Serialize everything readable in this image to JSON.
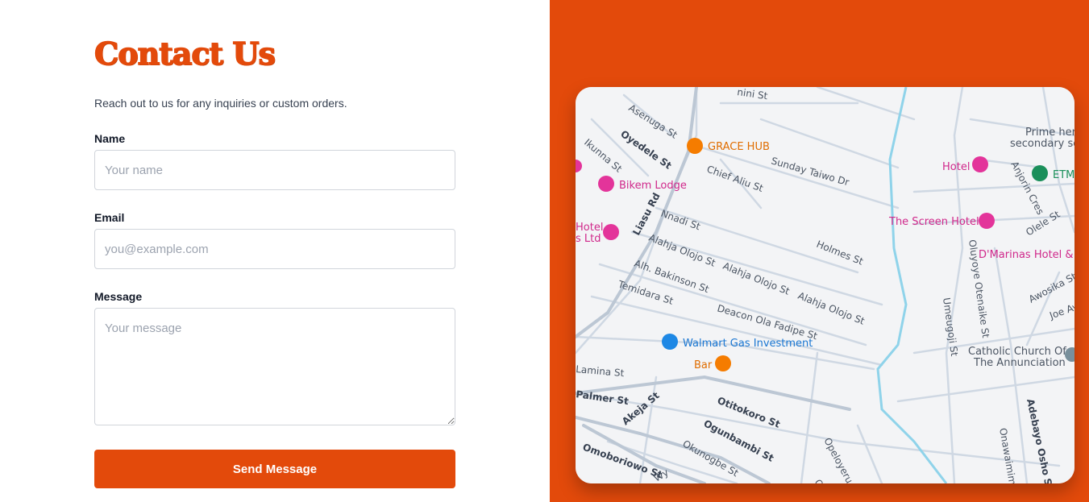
{
  "contact": {
    "title": "Contact Us",
    "subtitle": "Reach out to us for any inquiries or custom orders.",
    "name_label": "Name",
    "name_placeholder": "Your name",
    "email_label": "Email",
    "email_placeholder": "you@example.com",
    "message_label": "Message",
    "message_placeholder": "Your message",
    "submit_label": "Send Message",
    "accent_color": "#e34a0b"
  },
  "map": {
    "streets": [
      "Asenuga St",
      "Oyedele St",
      "Ikunna St",
      "Liasu Rd",
      "Chief Aliu St",
      "Sunday Taiwo Dr",
      "Nnadi St",
      "Alahja Olojo St",
      "Alahja Olojo St",
      "Alahja Olojo St",
      "Holmes St",
      "Alh. Bakinson St",
      "Temidara St",
      "Deacon Ola Fadipe St",
      "Lamina St",
      "Palmer St",
      "Akeja St",
      "Otitokoro St",
      "Ogunbambi St",
      "Okunogbe St",
      "Omoboriowo St",
      "Opeloyeru St",
      "Oluyoye Otenaike St",
      "Umeugoji St",
      "Olele St",
      "Anjorin Cres",
      "Awosika St",
      "Joe Ayik",
      "Adebayo Osho St",
      "Onawaimim",
      "Wy",
      "nini St",
      "Otto"
    ],
    "places": [
      {
        "name": "GRACE HUB",
        "icon": "bar-icon"
      },
      {
        "name": "Bikem Lodge",
        "icon": "hotel-icon"
      },
      {
        "name": "Hotel",
        "icon": "hotel-icon"
      },
      {
        "name": "s Ltd",
        "icon": "hotel-icon"
      },
      {
        "name": "Walmart Gas Investment",
        "icon": "shopping-icon"
      },
      {
        "name": "Bar",
        "icon": "bar-icon"
      },
      {
        "name": "Hotel",
        "icon": "hotel-icon"
      },
      {
        "name": "The Screen Hotel",
        "icon": "hotel-icon"
      },
      {
        "name": "D'Marinas Hotel & S",
        "icon": "hotel-icon"
      },
      {
        "name": "ETM",
        "icon": "place-icon"
      },
      {
        "name": "Prime her",
        "icon": ""
      },
      {
        "name": "secondary sc",
        "icon": ""
      },
      {
        "name": "Catholic Church Of",
        "icon": "church-icon"
      },
      {
        "name": "The Annunciation",
        "icon": ""
      }
    ]
  }
}
